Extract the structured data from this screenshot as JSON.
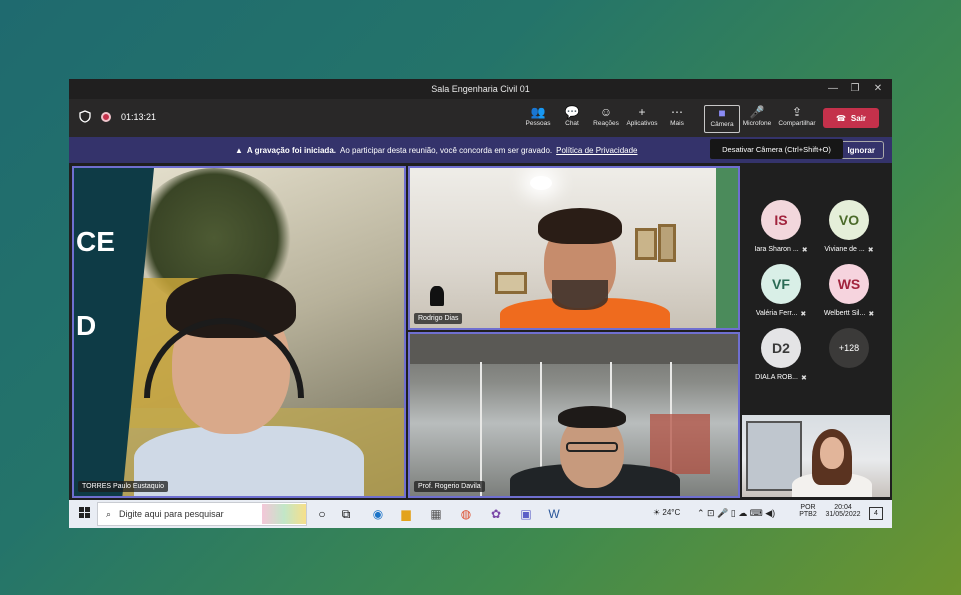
{
  "window": {
    "title": "Sala Engenharia Civil 01",
    "minimize_glyph": "—",
    "restore_glyph": "❐",
    "close_glyph": "✕"
  },
  "toolbar": {
    "timer": "01:13:21",
    "pessoas": "Pessoas",
    "chat": "Chat",
    "reacoes": "Reações",
    "aplicativos": "Aplicativos",
    "mais": "Mais",
    "camera": "Câmera",
    "microfone": "Microfone",
    "compartilhar": "Compartilhar",
    "sair": "Sair"
  },
  "banner": {
    "bold": "A gravação foi iniciada.",
    "text": "Ao participar desta reunião, você concorda em ser gravado.",
    "link": "Política de Privacidade",
    "ignore": "Ignorar"
  },
  "tooltip": "Desativar Câmera (Ctrl+Shift+O)",
  "tiles": {
    "main": "TORRES Paulo Eustaquio",
    "top_right": "Rodrigo Dias",
    "bottom_right": "Prof. Rogerio Davila"
  },
  "poster_text": {
    "line1": "CE",
    "line2": "D"
  },
  "participants": [
    {
      "initials": "IS",
      "name": "Iara Sharon ...",
      "bg": "#f2d7dc",
      "fg": "#a1243d"
    },
    {
      "initials": "VO",
      "name": "Viviane de ...",
      "bg": "#e5efd9",
      "fg": "#4b6b2a"
    },
    {
      "initials": "VF",
      "name": "Valéria Ferr...",
      "bg": "#d9efe7",
      "fg": "#2b6b55"
    },
    {
      "initials": "WS",
      "name": "Welbertt Sil...",
      "bg": "#f6d4de",
      "fg": "#a1243d"
    },
    {
      "initials": "D2",
      "name": "DIALA ROB...",
      "bg": "#e4e4e6",
      "fg": "#3a3a3a"
    }
  ],
  "overflow_count": "+128",
  "taskbar": {
    "search_placeholder": "Digite aqui para pesquisar",
    "weather": "24°C",
    "lang1": "POR",
    "lang2": "PTB2",
    "time": "20:04",
    "date": "31/05/2022",
    "notif_count": "4"
  }
}
